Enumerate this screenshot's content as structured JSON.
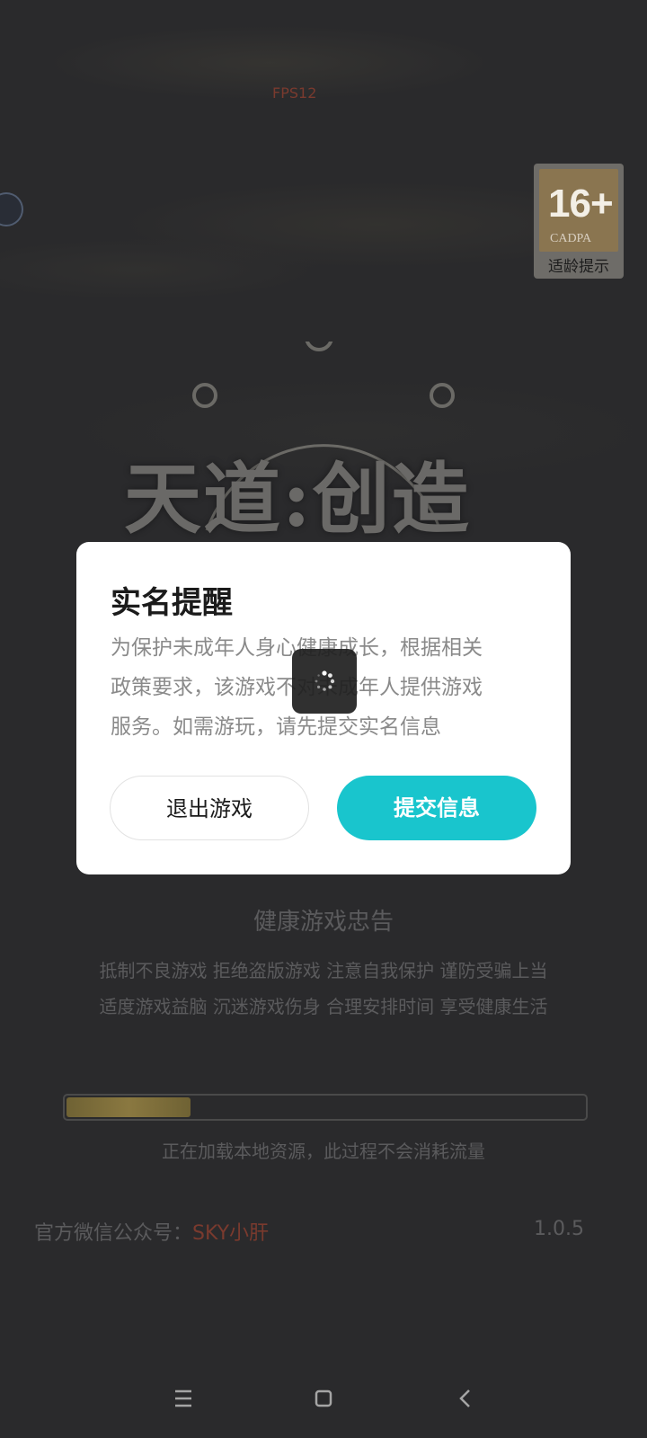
{
  "fps_label": "FPS12",
  "age_badge": {
    "rating": "16+",
    "org": "CADPA",
    "label": "适龄提示"
  },
  "logo_title": "天道:创造",
  "dialog": {
    "title": "实名提醒",
    "body_lines": [
      "为保护未成年人身心健康成长，根据相关",
      "政策要求，该游戏不对未成年人提供游戏",
      "服务。如需游玩，请先提交实名信息"
    ],
    "exit_label": "退出游戏",
    "submit_label": "提交信息"
  },
  "health_advice": {
    "title": "健康游戏忠告",
    "line1": "抵制不良游戏  拒绝盗版游戏  注意自我保护  谨防受骗上当",
    "line2": "适度游戏益脑  沉迷游戏伤身  合理安排时间  享受健康生活"
  },
  "loading": {
    "progress_fraction": 0.24,
    "text": "正在加载本地资源，此过程不会消耗流量"
  },
  "footer": {
    "wechat_label": "官方微信公众号：",
    "wechat_account": "SKY小肝",
    "version": "1.0.5"
  },
  "nav": {
    "icons": [
      "menu-icon",
      "home-icon",
      "back-icon"
    ]
  },
  "colors": {
    "accent": "#19c5cd",
    "background": "#2b2b2d"
  }
}
